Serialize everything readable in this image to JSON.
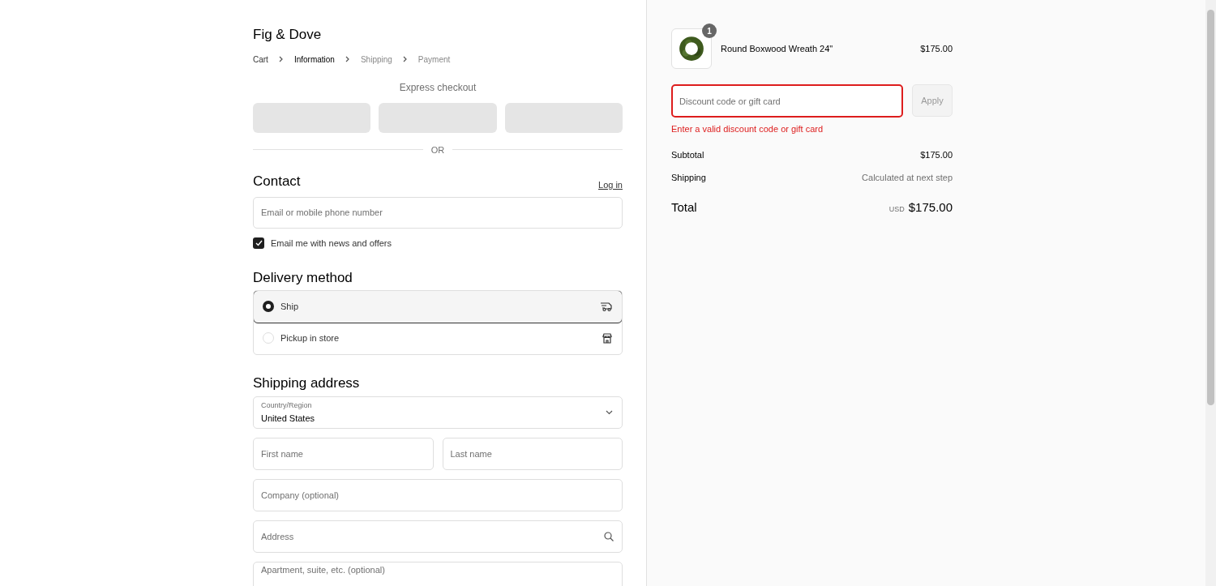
{
  "store": {
    "name": "Fig & Dove"
  },
  "breadcrumbs": [
    {
      "label": "Cart",
      "selected": false
    },
    {
      "label": "Information",
      "selected": true
    },
    {
      "label": "Shipping",
      "selected": false
    },
    {
      "label": "Payment",
      "selected": false
    }
  ],
  "express_checkout": {
    "title": "Express checkout"
  },
  "divider": "OR",
  "contact": {
    "title": "Contact",
    "login": "Log in",
    "email_placeholder": "Email or mobile phone number",
    "newsletter": {
      "label": "Email me with news and offers",
      "checked": true
    }
  },
  "delivery": {
    "title": "Delivery method",
    "options": [
      {
        "label": "Ship",
        "selected": true,
        "kind": "ship"
      },
      {
        "label": "Pickup in store",
        "selected": false,
        "kind": "store"
      }
    ]
  },
  "shipping_address": {
    "title": "Shipping address",
    "country": {
      "label": "Country/Region",
      "value": "United States"
    },
    "fields": [
      {
        "placeholder": "First name",
        "kind": "half"
      },
      {
        "placeholder": "Last name",
        "kind": "half"
      },
      {
        "placeholder": "Company (optional)",
        "kind": "full"
      },
      {
        "placeholder": "Address",
        "kind": "search"
      },
      {
        "placeholder": "Apartment, suite, etc. (optional)",
        "kind": "full"
      }
    ]
  },
  "summary": {
    "item": {
      "name": "Round Boxwood Wreath 24\"",
      "quantity": "1",
      "price": "$175.00"
    },
    "discount": {
      "placeholder": "Discount code or gift card",
      "button": "Apply",
      "error": "Enter a valid discount code or gift card"
    },
    "subtotal": {
      "label": "Subtotal",
      "value": "$175.00"
    },
    "shipping": {
      "label": "Shipping",
      "value": "Calculated at next step"
    },
    "total": {
      "label": "Total",
      "currency": "USD",
      "value": "$175.00"
    }
  }
}
